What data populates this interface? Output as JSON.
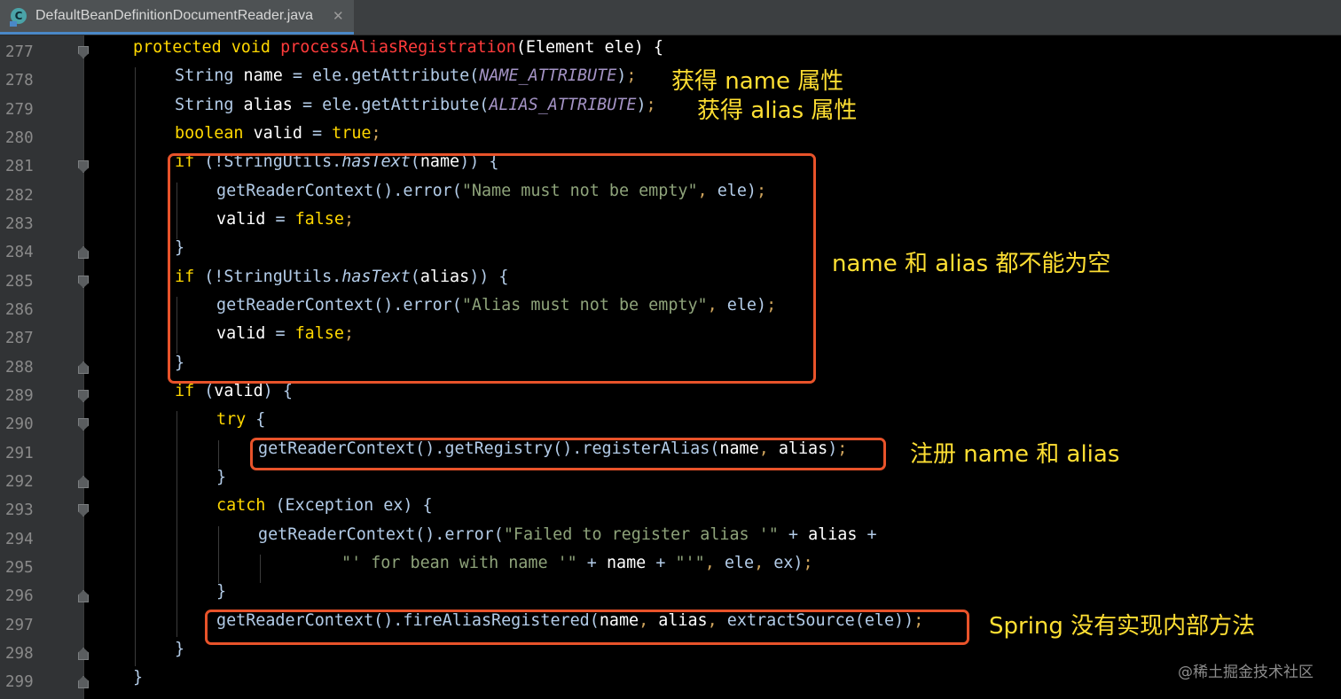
{
  "tab": {
    "icon_letter": "C",
    "filename": "DefaultBeanDefinitionDocumentReader.java",
    "close_glyph": "✕"
  },
  "line_numbers": [
    "277",
    "278",
    "279",
    "280",
    "281",
    "282",
    "283",
    "284",
    "285",
    "286",
    "287",
    "288",
    "289",
    "290",
    "291",
    "292",
    "293",
    "294",
    "295",
    "296",
    "297",
    "298",
    "299"
  ],
  "code": {
    "l277": {
      "protected_void": "protected void ",
      "method": "processAliasRegistration",
      "params": "(Element ele) {"
    },
    "l278": {
      "type": "String ",
      "var": "name",
      "eq": " = ele.getAttribute(",
      "const": "NAME_ATTRIBUTE",
      "end": ")",
      "semi": ";"
    },
    "l279": {
      "type": "String ",
      "var": "alias",
      "eq": " = ele.getAttribute(",
      "const": "ALIAS_ATTRIBUTE",
      "end": ")",
      "semi": ";"
    },
    "l280": {
      "kw": "boolean ",
      "var": "valid",
      "eq": " = ",
      "val": "true",
      "semi": ";"
    },
    "l281": {
      "kw": "if ",
      "open": "(!StringUtils.",
      "method": "hasText",
      "arg_open": "(",
      "arg": "name",
      "close": ")) {"
    },
    "l282": {
      "call": "getReaderContext().error(",
      "str": "\"Name must not be empty\"",
      "sep": ", ",
      "arg": "ele",
      "close": ")",
      "semi": ";"
    },
    "l283": {
      "var": "valid",
      "eq": " = ",
      "val": "false",
      "semi": ";"
    },
    "l284": {
      "brace": "}"
    },
    "l285": {
      "kw": "if ",
      "open": "(!StringUtils.",
      "method": "hasText",
      "arg_open": "(",
      "arg": "alias",
      "close": ")) {"
    },
    "l286": {
      "call": "getReaderContext().error(",
      "str": "\"Alias must not be empty\"",
      "sep": ", ",
      "arg": "ele",
      "close": ")",
      "semi": ";"
    },
    "l287": {
      "var": "valid",
      "eq": " = ",
      "val": "false",
      "semi": ";"
    },
    "l288": {
      "brace": "}"
    },
    "l289": {
      "kw": "if ",
      "open": "(",
      "var": "valid",
      "close": ") {"
    },
    "l290": {
      "kw": "try",
      "close": " {"
    },
    "l291": {
      "call": "getReaderContext().getRegistry().registerAlias(",
      "a1": "name",
      "sep": ", ",
      "a2": "alias",
      "close": ")",
      "semi": ";"
    },
    "l292": {
      "brace": "}"
    },
    "l293": {
      "kw": "catch",
      "rest": " (Exception ex) {"
    },
    "l294": {
      "call": "getReaderContext().error(",
      "str": "\"Failed to register alias '\"",
      "plus": " + ",
      "var": "alias",
      "plus2": " +"
    },
    "l295": {
      "str": "\"' for bean with name '\"",
      "plus": " + ",
      "var": "name",
      "plus2": " + ",
      "str2": "\"'\"",
      "sep": ", ",
      "a1": "ele",
      "sep2": ", ",
      "a2": "ex",
      "close": ")",
      "semi": ";"
    },
    "l296": {
      "brace": "}"
    },
    "l297": {
      "call": "getReaderContext().fireAliasRegistered(",
      "a1": "name",
      "sep": ", ",
      "a2": "alias",
      "sep2": ", ",
      "call2": "extractSource(",
      "a3": "ele",
      "close": "))",
      "semi": ";"
    },
    "l298": {
      "brace": "}"
    },
    "l299": {
      "brace": "}"
    }
  },
  "annotations": {
    "name_attr": "获得 name 属性",
    "alias_attr": "获得 alias 属性",
    "not_empty": "name 和 alias 都不能为空",
    "register": "注册 name 和 alias",
    "fire": "Spring 没有实现内部方法"
  },
  "watermark": "@稀土掘金技术社区",
  "colors": {
    "highlight_box": "#e8532a",
    "annotation_text": "#ffdf33",
    "keyword": "#ffd700",
    "method_decl": "#ff3b3b",
    "string": "#8ea37a",
    "constant": "#a594c6"
  }
}
